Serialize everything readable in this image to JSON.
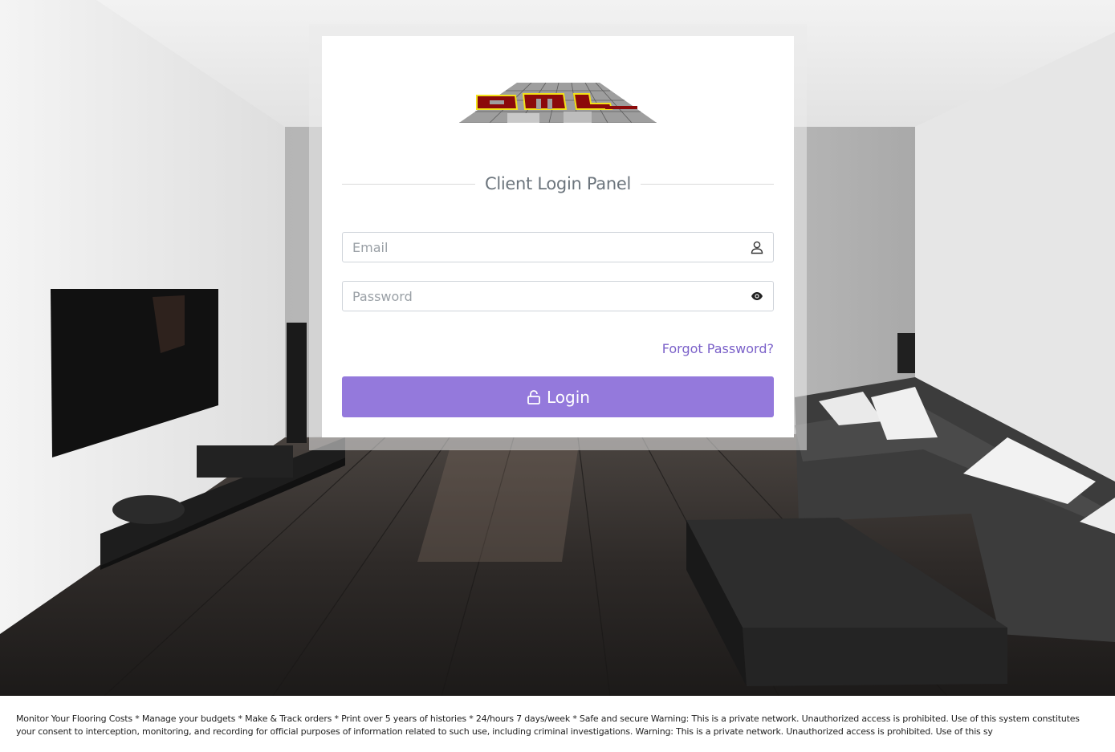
{
  "login_panel": {
    "title": "Client Login Panel",
    "email_placeholder": "Email",
    "password_placeholder": "Password",
    "forgot_password_label": "Forgot Password?",
    "login_label": "Login",
    "icons": {
      "email": "user-icon",
      "password": "eye-icon",
      "login": "lock-icon"
    }
  },
  "logo": {
    "text": "AML",
    "colors": {
      "letters": "#8b0a0a",
      "outline": "#f2e21a",
      "floor": "#9e9e9e"
    }
  },
  "footer": {
    "text": "Monitor Your Flooring Costs * Manage your budgets * Make & Track orders * Print over 5 years of histories * 24/hours 7 days/week * Safe and secure Warning: This is a private network. Unauthorized access is prohibited. Use of this system constitutes your consent to interception, monitoring, and recording for official purposes of information related to such use, including criminal investigations. Warning: This is a private network. Unauthorized access is prohibited. Use of this sy"
  },
  "theme": {
    "accent": "#9479dc",
    "link": "#7b61c9",
    "title": "#6c757d"
  }
}
